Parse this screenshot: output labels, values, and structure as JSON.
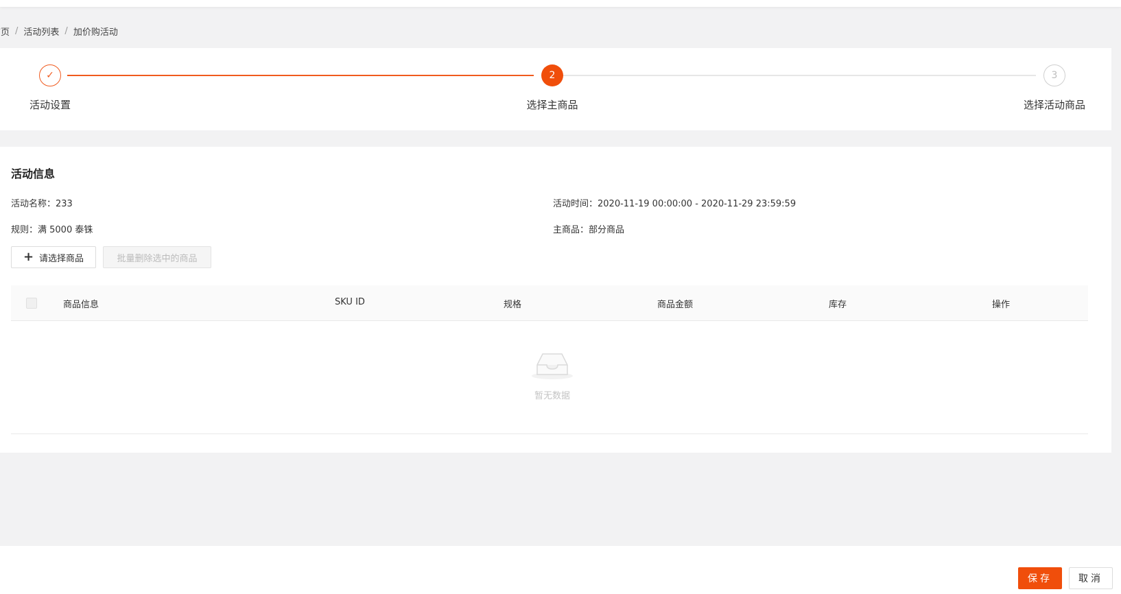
{
  "breadcrumb": {
    "items": [
      "首页",
      "活动列表",
      "加价购活动"
    ],
    "separator": "/"
  },
  "steps": [
    {
      "label": "活动设置",
      "status": "done",
      "marker": "✓"
    },
    {
      "label": "选择主商品",
      "status": "active",
      "marker": "2"
    },
    {
      "label": "选择活动商品",
      "status": "wait",
      "marker": "3"
    }
  ],
  "info": {
    "title": "活动信息",
    "name": "活动名称：233",
    "time": "活动时间：2020-11-19 00:00:00 - 2020-11-29 23:59:59",
    "rule": "规则：满 5000 泰铢",
    "main_goods": "主商品：部分商品"
  },
  "actions": {
    "select_goods": "请选择商品",
    "batch_delete": "批量删除选中的商品"
  },
  "table": {
    "columns": [
      "商品信息",
      "SKU ID",
      "规格",
      "商品金额",
      "库存",
      "操作"
    ],
    "empty_text": "暂无数据"
  },
  "footer": {
    "save": "保存",
    "cancel": "取消"
  },
  "colors": {
    "accent": "#f04e0b",
    "background": "#f2f2f3"
  }
}
